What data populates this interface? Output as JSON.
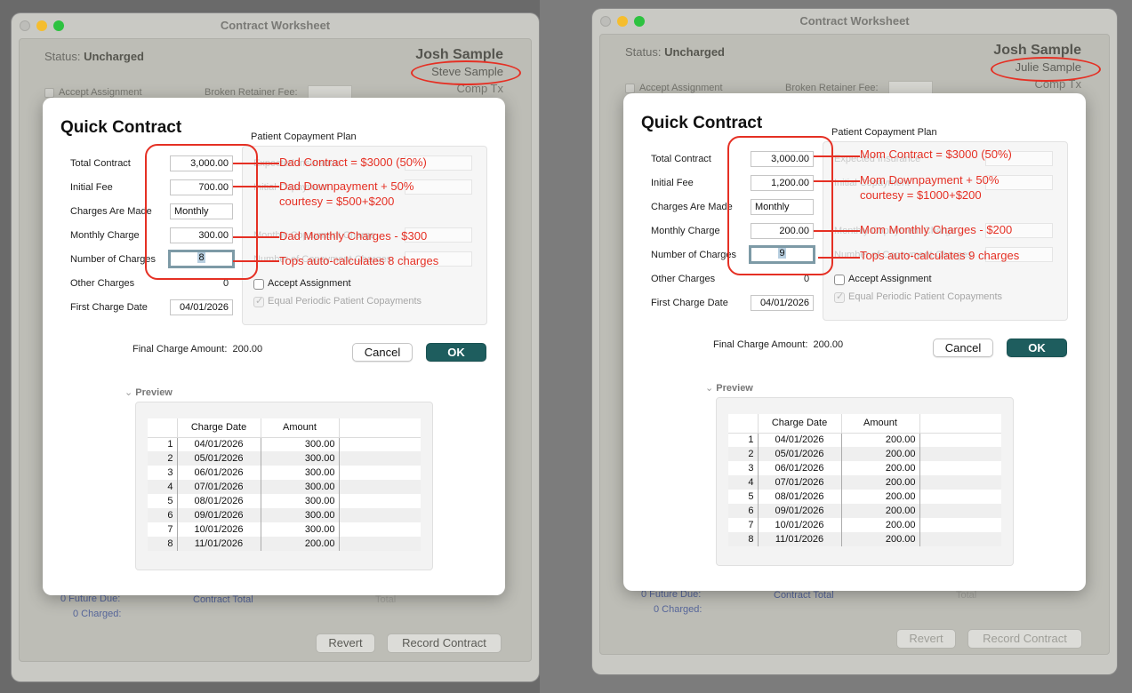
{
  "colors": {
    "accent_ok": "#1e5d5e",
    "annotation_red": "#e53024",
    "focus_ring": "#7d9aa6"
  },
  "windows": [
    {
      "title": "Contract Worksheet",
      "status_label": "Status:",
      "status_value": "Uncharged",
      "patient": "Josh Sample",
      "responsible": "Steve Sample",
      "comp_tx": "Comp Tx",
      "accept_assignment_bg": "Accept Assignment",
      "broken_fee": "Broken Retainer Fee:",
      "future_due": "0 Future Due:",
      "charged": "0 Charged:",
      "contract_total": "Contract Total",
      "total": "Total",
      "revert": "Revert",
      "record_contract": "Record Contract",
      "dialog": {
        "title": "Quick Contract",
        "labels": {
          "total_contract": "Total Contract",
          "initial_fee": "Initial Fee",
          "charges_made": "Charges Are Made",
          "monthly_charge": "Monthly Charge",
          "num_charges": "Number of Charges",
          "other_charges": "Other Charges",
          "first_date": "First Charge Date"
        },
        "values": {
          "total_contract": "3,000.00",
          "initial_fee": "700.00",
          "charges_made": "Monthly",
          "monthly_charge": "300.00",
          "num_charges": "8",
          "other_charges": "0",
          "first_date": "04/01/2026"
        },
        "copay_title": "Patient Copayment Plan",
        "copay_ghosts": [
          "Expected Insurance",
          "Initial Copayment",
          "Monthly Copayment Charge",
          "Number of Copayment Charges"
        ],
        "accept_assignment": "Accept Assignment",
        "equal_periodic": "Equal Periodic Patient Copayments",
        "final_label": "Final Charge Amount:",
        "final_value": "200.00",
        "cancel": "Cancel",
        "ok": "OK",
        "preview": "Preview",
        "columns": [
          "Charge Date",
          "Amount"
        ],
        "rows": [
          [
            "1",
            "04/01/2026",
            "300.00"
          ],
          [
            "2",
            "05/01/2026",
            "300.00"
          ],
          [
            "3",
            "06/01/2026",
            "300.00"
          ],
          [
            "4",
            "07/01/2026",
            "300.00"
          ],
          [
            "5",
            "08/01/2026",
            "300.00"
          ],
          [
            "6",
            "09/01/2026",
            "300.00"
          ],
          [
            "7",
            "10/01/2026",
            "300.00"
          ],
          [
            "8",
            "11/01/2026",
            "200.00"
          ]
        ]
      },
      "notes": {
        "contract": "Dad Contract = $3000 (50%)",
        "down1": "Dad Downpayment + 50%",
        "down2": "courtesy = $500+$200",
        "monthly": "Dad Monthly Charges - $300",
        "tops": "Tops auto-calculates 8 charges"
      }
    },
    {
      "title": "Contract Worksheet",
      "status_label": "Status:",
      "status_value": "Uncharged",
      "patient": "Josh Sample",
      "responsible": "Julie Sample",
      "comp_tx": "Comp Tx",
      "accept_assignment_bg": "Accept Assignment",
      "broken_fee": "Broken Retainer Fee:",
      "future_due": "0 Future Due:",
      "charged": "0 Charged:",
      "contract_total": "Contract Total",
      "total": "Total",
      "revert": "Revert",
      "record_contract": "Record Contract",
      "dialog": {
        "title": "Quick Contract",
        "labels": {
          "total_contract": "Total Contract",
          "initial_fee": "Initial Fee",
          "charges_made": "Charges Are Made",
          "monthly_charge": "Monthly Charge",
          "num_charges": "Number of Charges",
          "other_charges": "Other Charges",
          "first_date": "First Charge Date"
        },
        "values": {
          "total_contract": "3,000.00",
          "initial_fee": "1,200.00",
          "charges_made": "Monthly",
          "monthly_charge": "200.00",
          "num_charges": "9",
          "other_charges": "0",
          "first_date": "04/01/2026"
        },
        "copay_title": "Patient Copayment Plan",
        "copay_ghosts": [
          "Expected Insurance",
          "Initial Copayment",
          "Monthly Copayment Charge",
          "Number of Copayment Charges"
        ],
        "accept_assignment": "Accept Assignment",
        "equal_periodic": "Equal Periodic Patient Copayments",
        "final_label": "Final Charge Amount:",
        "final_value": "200.00",
        "cancel": "Cancel",
        "ok": "OK",
        "preview": "Preview",
        "columns": [
          "Charge Date",
          "Amount"
        ],
        "rows": [
          [
            "1",
            "04/01/2026",
            "200.00"
          ],
          [
            "2",
            "05/01/2026",
            "200.00"
          ],
          [
            "3",
            "06/01/2026",
            "200.00"
          ],
          [
            "4",
            "07/01/2026",
            "200.00"
          ],
          [
            "5",
            "08/01/2026",
            "200.00"
          ],
          [
            "6",
            "09/01/2026",
            "200.00"
          ],
          [
            "7",
            "10/01/2026",
            "200.00"
          ],
          [
            "8",
            "11/01/2026",
            "200.00"
          ]
        ]
      },
      "notes": {
        "contract": "Mom Contract = $3000 (50%)",
        "down1": "Mom Downpayment + 50%",
        "down2": "courtesy = $1000+$200",
        "monthly": "Mom Monthly Charges - $200",
        "tops": "Tops auto-calculates 9 charges"
      }
    }
  ]
}
